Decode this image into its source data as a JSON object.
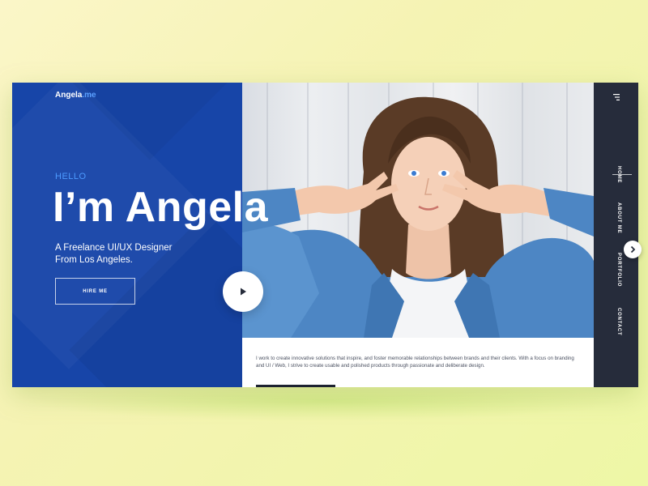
{
  "brand": {
    "name": "Angela",
    "suffix": ".me"
  },
  "hero": {
    "greeting": "HELLO",
    "headline": "I’m Angela",
    "subline_1": "A Freelance UI/UX Designer",
    "subline_2": "From Los Angeles.",
    "cta_label": "HIRE ME"
  },
  "bio": {
    "text": "I work to create innovative solutions that inspire, and foster memorable relationships between brands and their clients. With a focus on branding and UI / Web, I strive to create usable and polished products through passionate and deliberate design."
  },
  "nav": {
    "items": [
      {
        "label": "HOME"
      },
      {
        "label": "ABOUT ME"
      },
      {
        "label": "PORTFOLIO"
      },
      {
        "label": "CONTACT"
      }
    ],
    "active": "HOME"
  },
  "icons": {
    "menu": "hamburger-menu-icon",
    "play": "play-icon",
    "next": "chevron-right-icon"
  },
  "colors": {
    "primary_blue": "#1745a8",
    "accent_blue": "#4d9bff",
    "nav_dark": "#262c3b",
    "background": "#f5f3b3"
  }
}
